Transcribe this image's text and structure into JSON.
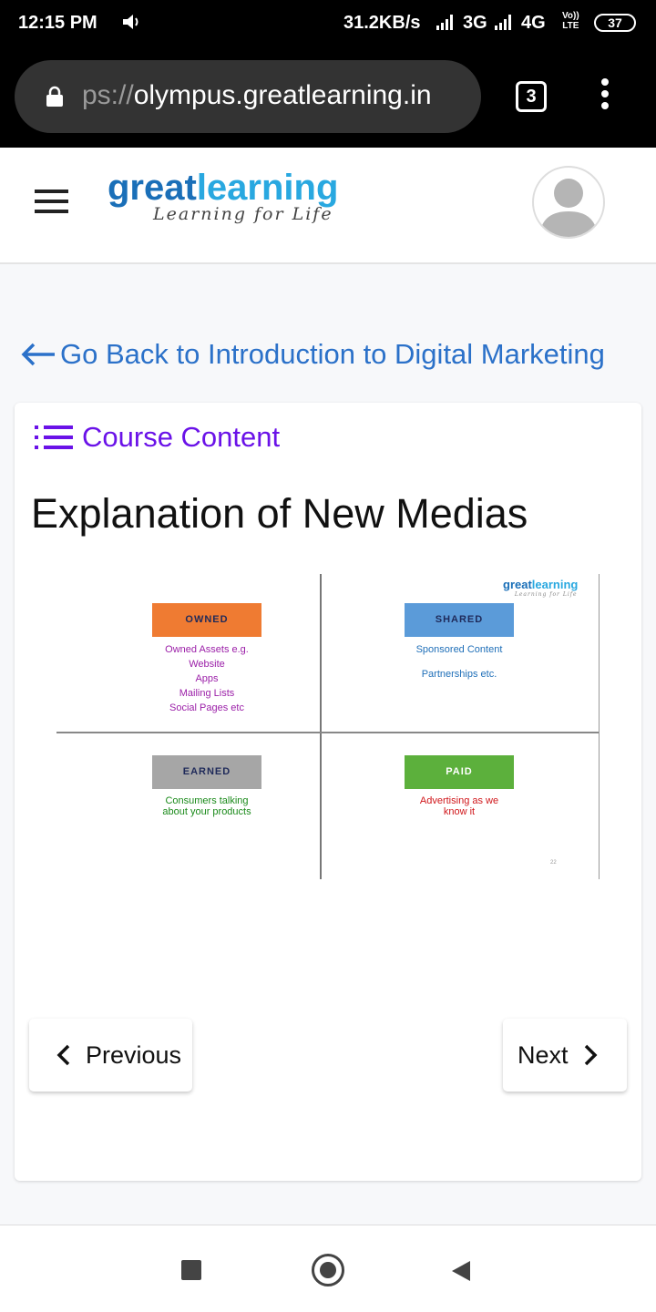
{
  "status_bar": {
    "time": "12:15 PM",
    "network_speed": "31.2KB/s",
    "sim1_type": "3G",
    "sim2_type": "4G",
    "volte_line1": "Vo))",
    "volte_line2": "LTE",
    "battery": "37"
  },
  "browser": {
    "url_scheme": "ps://",
    "url_host": "olympus.greatlearning.in",
    "tab_count": "3"
  },
  "header": {
    "logo_word_part1": "great",
    "logo_word_part2": "learning",
    "logo_tagline": "Learning for Life",
    "brand_colors": {
      "dark": "#1a6fb8",
      "light": "#29a8e0"
    }
  },
  "back_link": {
    "label": "Go Back to Introduction to Digital Marketing",
    "color": "#2b71c9"
  },
  "course_content": {
    "label": "Course Content",
    "color": "#6a12e8"
  },
  "lesson": {
    "title": "Explanation of New Medias"
  },
  "slide": {
    "logo_word_part1": "great",
    "logo_word_part2": "learning",
    "logo_tagline": "Learning for Life",
    "page_number": "22",
    "quadrants": [
      {
        "label": "OWNED",
        "label_color": "#ef7b32",
        "text_color": "#9b1fa8",
        "lines": [
          "Owned Assets e.g.",
          "Website",
          "Apps",
          "Mailing Lists",
          "Social Pages etc"
        ]
      },
      {
        "label": "SHARED",
        "label_color": "#5b9bd9",
        "text_color": "#1f6fb8",
        "lines": [
          "Sponsored Content",
          "",
          "Partnerships etc."
        ]
      },
      {
        "label": "EARNED",
        "label_color": "#a6a6a6",
        "text_color": "#1a8a1a",
        "lines": [
          "Consumers talking",
          "about your products"
        ]
      },
      {
        "label": "PAID",
        "label_color": "#5cb03c",
        "text_color": "#d0161a",
        "lines": [
          "Advertising as we",
          "know it"
        ]
      }
    ]
  },
  "navigation": {
    "previous_label": "Previous",
    "next_label": "Next"
  }
}
